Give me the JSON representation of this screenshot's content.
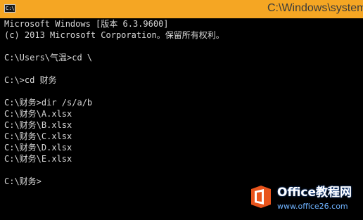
{
  "window": {
    "icon_label": "C:\\",
    "title": "C:\\Windows\\system"
  },
  "console": {
    "lines": [
      "Microsoft Windows [版本 6.3.9600]",
      "(c) 2013 Microsoft Corporation。保留所有权利。",
      "",
      "C:\\Users\\气温>cd \\",
      "",
      "C:\\>cd 财务",
      "",
      "C:\\财务>dir /s/a/b",
      "C:\\财务\\A.xlsx",
      "C:\\财务\\B.xlsx",
      "C:\\财务\\C.xlsx",
      "C:\\财务\\D.xlsx",
      "C:\\财务\\E.xlsx",
      "",
      "C:\\财务>"
    ]
  },
  "watermark": {
    "brand": "Office教程网",
    "url": "www.office26.com"
  },
  "colors": {
    "titlebar": "#f5a623",
    "console_bg": "#000000",
    "console_text": "#d8d8d8",
    "logo_orange": "#e8541c"
  }
}
